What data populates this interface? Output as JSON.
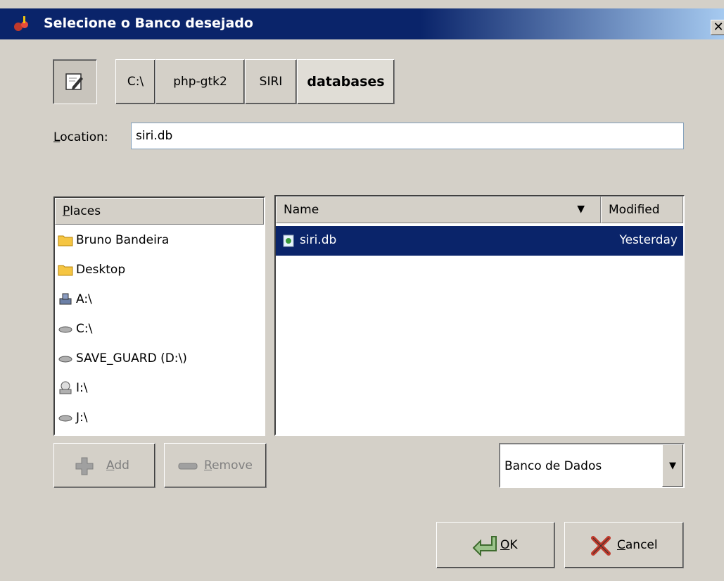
{
  "window": {
    "title": "Selecione o Banco desejado",
    "close_glyph": "✕"
  },
  "path_bar": {
    "edit_icon": "edit-location-icon",
    "crumbs": [
      "C:\\",
      "php-gtk2",
      "SIRI",
      "databases"
    ],
    "active_crumb": "databases"
  },
  "location": {
    "label_prefix": "L",
    "label_rest": "ocation:",
    "value": "siri.db"
  },
  "places": {
    "header_prefix": "P",
    "header_rest": "laces",
    "items": [
      {
        "label": "Bruno Bandeira",
        "icon": "folder-icon"
      },
      {
        "label": "Desktop",
        "icon": "folder-icon"
      },
      {
        "label": "A:\\",
        "icon": "floppy-drive-icon"
      },
      {
        "label": "C:\\",
        "icon": "hard-drive-icon"
      },
      {
        "label": "SAVE_GUARD (D:\\)",
        "icon": "hard-drive-icon"
      },
      {
        "label": "I:\\",
        "icon": "cdrom-drive-icon"
      },
      {
        "label": "J:\\",
        "icon": "hard-drive-icon"
      }
    ]
  },
  "files": {
    "columns": {
      "name": "Name",
      "modified": "Modified",
      "sort_glyph": "▼"
    },
    "rows": [
      {
        "name": "siri.db",
        "modified": "Yesterday",
        "selected": true,
        "icon": "database-file-icon"
      }
    ]
  },
  "buttons": {
    "add": {
      "prefix": "A",
      "rest": "dd",
      "disabled": true,
      "icon": "plus-icon"
    },
    "remove": {
      "prefix": "R",
      "rest": "emove",
      "disabled": true,
      "icon": "minus-icon"
    },
    "ok": {
      "prefix": "O",
      "rest": "K",
      "icon": "ok-arrow-icon"
    },
    "cancel": {
      "prefix": "C",
      "rest": "ancel",
      "icon": "cancel-x-icon"
    }
  },
  "filter": {
    "value": "Banco de Dados",
    "arrow_glyph": "▼"
  },
  "colors": {
    "title_bar": "#0a246a",
    "selection": "#0a246a",
    "dialog_bg": "#d4d0c8"
  }
}
